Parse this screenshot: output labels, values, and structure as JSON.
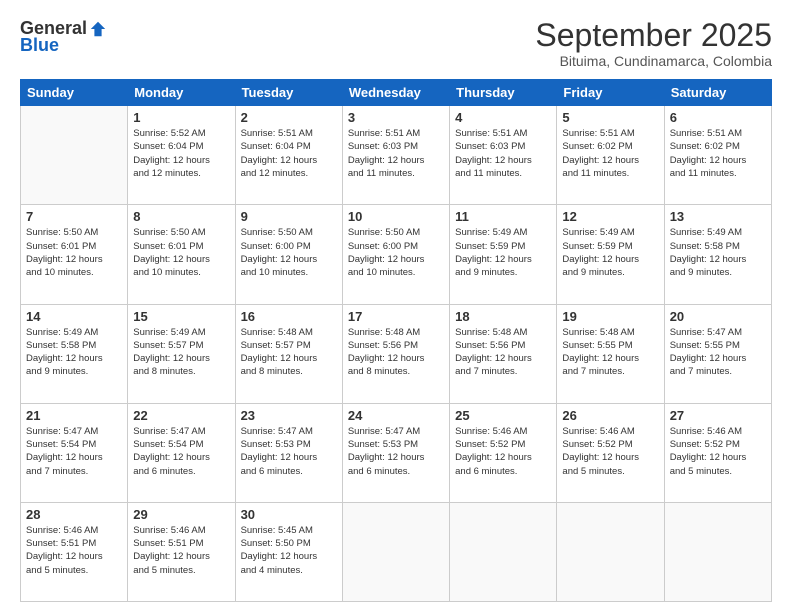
{
  "logo": {
    "general": "General",
    "blue": "Blue"
  },
  "header": {
    "title": "September 2025",
    "location": "Bituima, Cundinamarca, Colombia"
  },
  "weekdays": [
    "Sunday",
    "Monday",
    "Tuesday",
    "Wednesday",
    "Thursday",
    "Friday",
    "Saturday"
  ],
  "weeks": [
    [
      {
        "day": "",
        "info": ""
      },
      {
        "day": "1",
        "info": "Sunrise: 5:52 AM\nSunset: 6:04 PM\nDaylight: 12 hours\nand 12 minutes."
      },
      {
        "day": "2",
        "info": "Sunrise: 5:51 AM\nSunset: 6:04 PM\nDaylight: 12 hours\nand 12 minutes."
      },
      {
        "day": "3",
        "info": "Sunrise: 5:51 AM\nSunset: 6:03 PM\nDaylight: 12 hours\nand 11 minutes."
      },
      {
        "day": "4",
        "info": "Sunrise: 5:51 AM\nSunset: 6:03 PM\nDaylight: 12 hours\nand 11 minutes."
      },
      {
        "day": "5",
        "info": "Sunrise: 5:51 AM\nSunset: 6:02 PM\nDaylight: 12 hours\nand 11 minutes."
      },
      {
        "day": "6",
        "info": "Sunrise: 5:51 AM\nSunset: 6:02 PM\nDaylight: 12 hours\nand 11 minutes."
      }
    ],
    [
      {
        "day": "7",
        "info": "Sunrise: 5:50 AM\nSunset: 6:01 PM\nDaylight: 12 hours\nand 10 minutes."
      },
      {
        "day": "8",
        "info": "Sunrise: 5:50 AM\nSunset: 6:01 PM\nDaylight: 12 hours\nand 10 minutes."
      },
      {
        "day": "9",
        "info": "Sunrise: 5:50 AM\nSunset: 6:00 PM\nDaylight: 12 hours\nand 10 minutes."
      },
      {
        "day": "10",
        "info": "Sunrise: 5:50 AM\nSunset: 6:00 PM\nDaylight: 12 hours\nand 10 minutes."
      },
      {
        "day": "11",
        "info": "Sunrise: 5:49 AM\nSunset: 5:59 PM\nDaylight: 12 hours\nand 9 minutes."
      },
      {
        "day": "12",
        "info": "Sunrise: 5:49 AM\nSunset: 5:59 PM\nDaylight: 12 hours\nand 9 minutes."
      },
      {
        "day": "13",
        "info": "Sunrise: 5:49 AM\nSunset: 5:58 PM\nDaylight: 12 hours\nand 9 minutes."
      }
    ],
    [
      {
        "day": "14",
        "info": "Sunrise: 5:49 AM\nSunset: 5:58 PM\nDaylight: 12 hours\nand 9 minutes."
      },
      {
        "day": "15",
        "info": "Sunrise: 5:49 AM\nSunset: 5:57 PM\nDaylight: 12 hours\nand 8 minutes."
      },
      {
        "day": "16",
        "info": "Sunrise: 5:48 AM\nSunset: 5:57 PM\nDaylight: 12 hours\nand 8 minutes."
      },
      {
        "day": "17",
        "info": "Sunrise: 5:48 AM\nSunset: 5:56 PM\nDaylight: 12 hours\nand 8 minutes."
      },
      {
        "day": "18",
        "info": "Sunrise: 5:48 AM\nSunset: 5:56 PM\nDaylight: 12 hours\nand 7 minutes."
      },
      {
        "day": "19",
        "info": "Sunrise: 5:48 AM\nSunset: 5:55 PM\nDaylight: 12 hours\nand 7 minutes."
      },
      {
        "day": "20",
        "info": "Sunrise: 5:47 AM\nSunset: 5:55 PM\nDaylight: 12 hours\nand 7 minutes."
      }
    ],
    [
      {
        "day": "21",
        "info": "Sunrise: 5:47 AM\nSunset: 5:54 PM\nDaylight: 12 hours\nand 7 minutes."
      },
      {
        "day": "22",
        "info": "Sunrise: 5:47 AM\nSunset: 5:54 PM\nDaylight: 12 hours\nand 6 minutes."
      },
      {
        "day": "23",
        "info": "Sunrise: 5:47 AM\nSunset: 5:53 PM\nDaylight: 12 hours\nand 6 minutes."
      },
      {
        "day": "24",
        "info": "Sunrise: 5:47 AM\nSunset: 5:53 PM\nDaylight: 12 hours\nand 6 minutes."
      },
      {
        "day": "25",
        "info": "Sunrise: 5:46 AM\nSunset: 5:52 PM\nDaylight: 12 hours\nand 6 minutes."
      },
      {
        "day": "26",
        "info": "Sunrise: 5:46 AM\nSunset: 5:52 PM\nDaylight: 12 hours\nand 5 minutes."
      },
      {
        "day": "27",
        "info": "Sunrise: 5:46 AM\nSunset: 5:52 PM\nDaylight: 12 hours\nand 5 minutes."
      }
    ],
    [
      {
        "day": "28",
        "info": "Sunrise: 5:46 AM\nSunset: 5:51 PM\nDaylight: 12 hours\nand 5 minutes."
      },
      {
        "day": "29",
        "info": "Sunrise: 5:46 AM\nSunset: 5:51 PM\nDaylight: 12 hours\nand 5 minutes."
      },
      {
        "day": "30",
        "info": "Sunrise: 5:45 AM\nSunset: 5:50 PM\nDaylight: 12 hours\nand 4 minutes."
      },
      {
        "day": "",
        "info": ""
      },
      {
        "day": "",
        "info": ""
      },
      {
        "day": "",
        "info": ""
      },
      {
        "day": "",
        "info": ""
      }
    ]
  ]
}
